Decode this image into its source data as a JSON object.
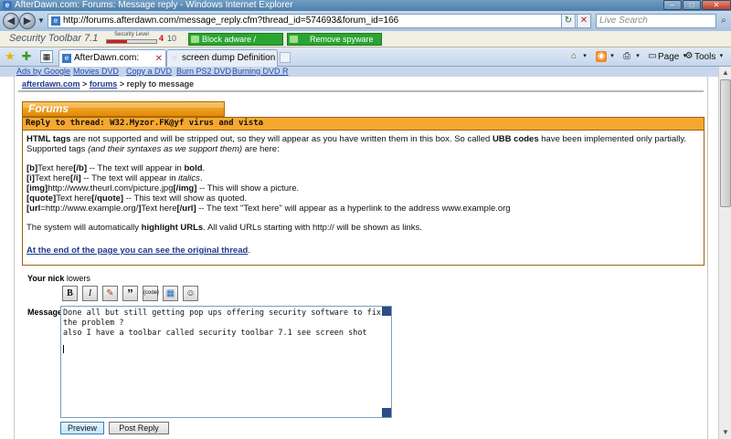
{
  "window": {
    "title": "AfterDawn.com: Forums: Message reply - Windows Internet Explorer",
    "minimize": "–",
    "maximize": "□",
    "close": "✕"
  },
  "address_bar": {
    "url": "http://forums.afterdawn.com/message_reply.cfm?thread_id=574693&forum_id=166",
    "search_placeholder": "Live Search"
  },
  "security_toolbar": {
    "name": "Security Toolbar 7.1",
    "level_label": "Security Level",
    "level_value": "4",
    "level_max": "10",
    "level_fraction": 0.4,
    "block_button": "Block adware / popups",
    "remove_button": "Remove spyware"
  },
  "tabs": [
    {
      "label": "AfterDawn.com: Forum...",
      "active": true
    },
    {
      "label": "screen dump Definition",
      "active": false
    }
  ],
  "command_bar": {
    "page": "Page",
    "tools": "Tools"
  },
  "ads_bar": [
    "Ads by Google",
    "Movies DVD",
    "Copy a DVD",
    "Burn PS2 DVD",
    "Burning DVD R"
  ],
  "breadcrumb": {
    "home": "afterdawn.com",
    "sep1": ">",
    "forums": "forums",
    "rest": "> reply to message"
  },
  "forum_tab": "Forums",
  "reply_header": "Reply to thread: W32.Myzor.FK@yf virus and vista",
  "info": {
    "html_tags": "HTML tags",
    "intro_mid": "are not supported and will be stripped out, so they will appear as you have written them in this box. So called",
    "ubb_codes": "UBB codes",
    "intro_end": "have been implemented only partially.",
    "supported": "Supported tags",
    "supported_paren": "(and their syntaxes as we support them)",
    "supported_end": "are here:",
    "rules": {
      "b_open": "[b]",
      "b_text": "Text here",
      "b_close": "[/b]",
      "b_desc": "-- The text will appear in",
      "b_word": "bold",
      "i_open": "[i]",
      "i_text": "Text here",
      "i_close": "[/i]",
      "i_desc": "-- The text will appear in",
      "i_word": "italics",
      "img_open": "[img]",
      "img_text": "http://www.theurl.com/picture.jpg",
      "img_close": "[/img]",
      "img_desc": "-- This will show a picture.",
      "quote_open": "[quote]",
      "quote_text": "Text here",
      "quote_close": "[/quote]",
      "quote_desc": "-- This text will show as quoted.",
      "url_open": "[url",
      "url_eq": "=http://www.example.org/",
      "url_bracket": "]",
      "url_text": "Text here",
      "url_close": "[/url]",
      "url_desc": "-- The text \"Text here\" will appear as a hyperlink to the address www.example.org"
    },
    "auto_pre": "The system will automatically",
    "auto_bold": "highlight URLs",
    "auto_post": ". All valid URLs starting with http:// will be shown as links.",
    "original_link": "At the end of the page you can see the original thread",
    "original_dot": "."
  },
  "nick": {
    "label": "Your nick",
    "value": "lowers"
  },
  "ubb_buttons": [
    "B",
    "I",
    "✎",
    "”",
    "{code}",
    "▦",
    "☺"
  ],
  "message": {
    "label": "Message",
    "text": "Done all but still getting pop ups offering security software to fix\nthe problem ?\nalso I have a toolbar called security toolbar 7.1 see screen shot\n"
  },
  "buttons": {
    "preview": "Preview",
    "post": "Post Reply"
  }
}
